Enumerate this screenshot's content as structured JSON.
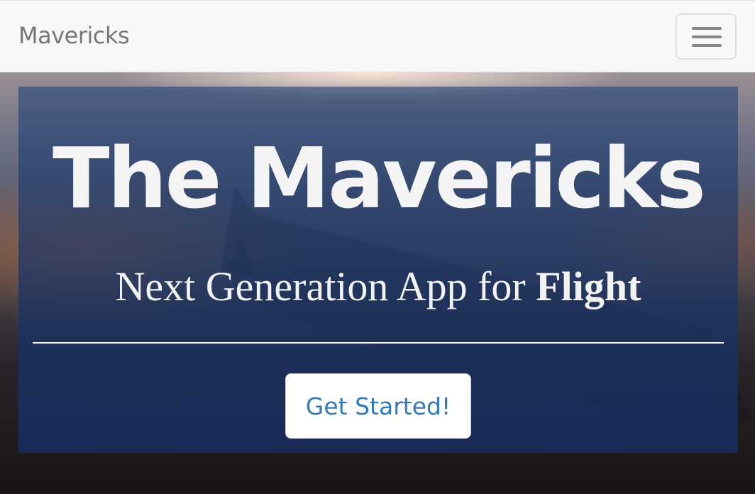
{
  "navbar": {
    "brand": "Mavericks",
    "toggle_icon": "hamburger-menu-icon"
  },
  "hero": {
    "title": "The Mavericks",
    "subtitle_prefix": "Next Generation App for ",
    "subtitle_emphasis": "Flight",
    "cta_label": "Get Started!"
  },
  "colors": {
    "navbar_bg": "#f8f8f8",
    "brand_text": "#777777",
    "panel_overlay": "#1f3a6e",
    "cta_text": "#337ab7",
    "cta_bg": "#ffffff"
  }
}
